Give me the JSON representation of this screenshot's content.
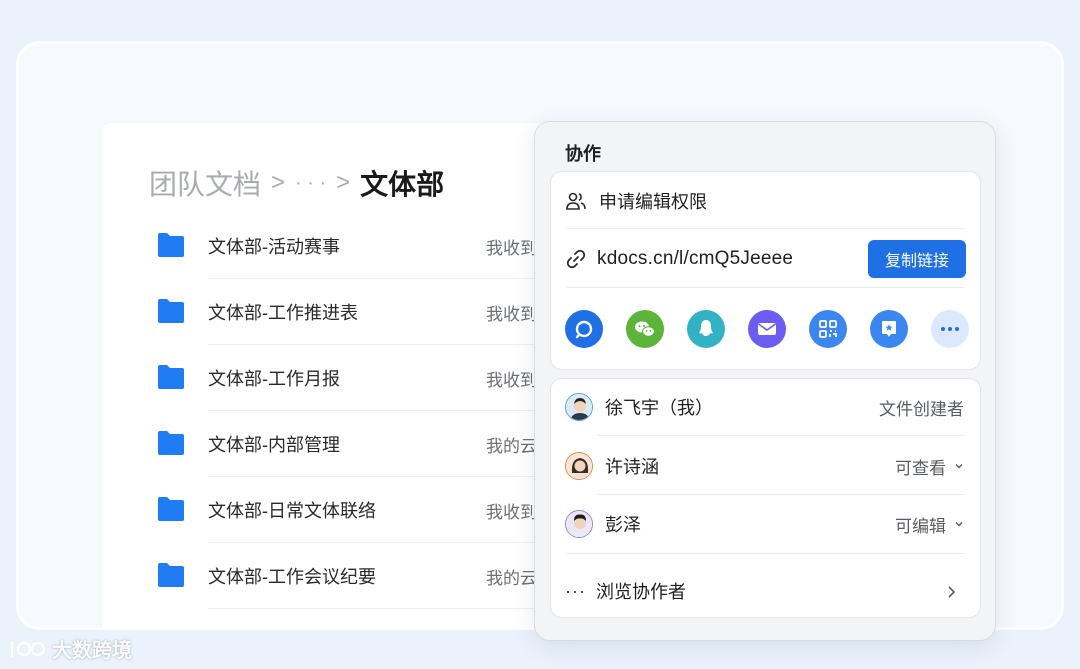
{
  "breadcrumb": {
    "root": "团队文档",
    "sep1": ">",
    "ellipsis": "· · ·",
    "sep2": ">",
    "current": "文体部"
  },
  "files": [
    {
      "name": "文体部-活动赛事",
      "owner": "我收到"
    },
    {
      "name": "文体部-工作推进表",
      "owner": "我收到"
    },
    {
      "name": "文体部-工作月报",
      "owner": "我收到"
    },
    {
      "name": "文体部-内部管理",
      "owner": "我的云"
    },
    {
      "name": "文体部-日常文体联络",
      "owner": "我收到"
    },
    {
      "name": "文体部-工作会议纪要",
      "owner": "我的云"
    }
  ],
  "collab": {
    "title": "协作",
    "request_edit": "申请编辑权限",
    "link_url": "kdocs.cn/l/cmQ5Jeeee",
    "copy_label": "复制链接",
    "share_icons": [
      {
        "name": "kdocs-chat-icon",
        "color": "#1f6fe5"
      },
      {
        "name": "wechat-icon",
        "color": "#5cb43a"
      },
      {
        "name": "qq-icon",
        "color": "#33b2c6"
      },
      {
        "name": "mail-icon",
        "color": "#6b5cf2"
      },
      {
        "name": "qrcode-icon",
        "color": "#3c86f0"
      },
      {
        "name": "bookmark-star-icon",
        "color": "#3c86f0"
      },
      {
        "name": "more-icon",
        "color": "#dce8fb"
      }
    ],
    "people": [
      {
        "name": "徐飞宇（我）",
        "role": "文件创建者",
        "dropdown": false
      },
      {
        "name": "许诗涵",
        "role": "可查看",
        "dropdown": true
      },
      {
        "name": "彭泽",
        "role": "可编辑",
        "dropdown": true
      }
    ],
    "browse_dots": "···",
    "browse_label": "浏览协作者"
  },
  "watermark": "大数跨境",
  "colors": {
    "accent": "#1f6fe5",
    "folder": "#1f7cf2",
    "background": "#eaf2fc"
  }
}
